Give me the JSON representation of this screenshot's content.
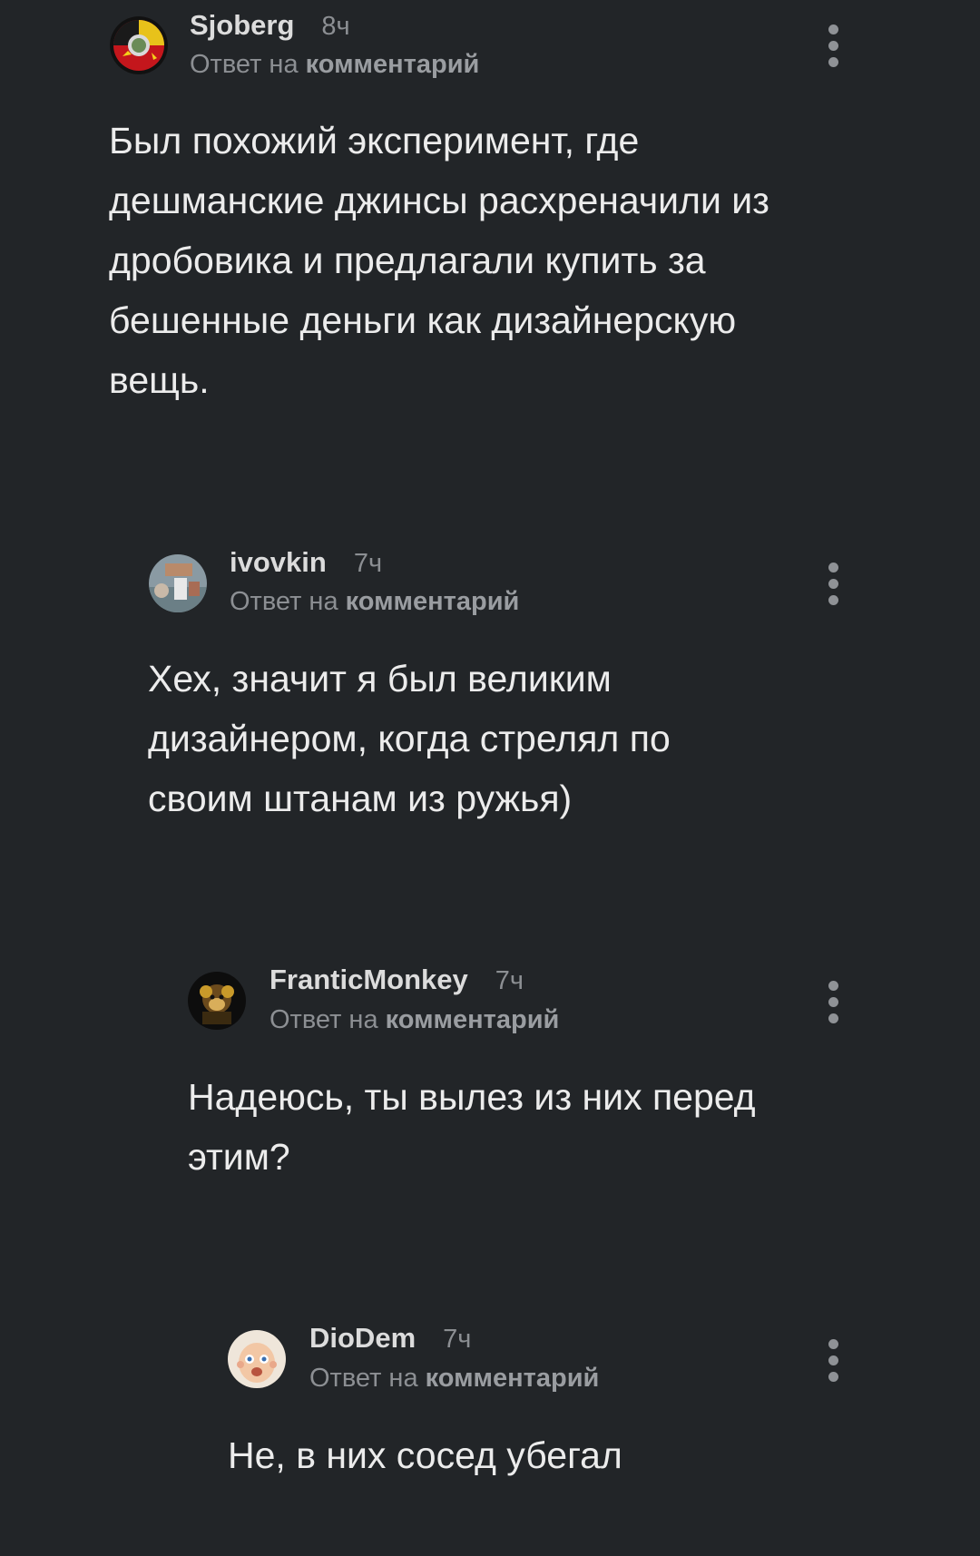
{
  "comments": [
    {
      "username": "Sjoberg",
      "time": "8ч",
      "reply_prefix": "Ответ на",
      "reply_link": "комментарий",
      "text": "Был похожий эксперимент, где дешманские джинсы расхреначили из дробовика и предлагали купить за бешенные деньги как  дизайнерскую вещь.",
      "avatar_icon": "soviet-emblem-avatar"
    },
    {
      "username": "ivovkin",
      "time": "7ч",
      "reply_prefix": "Ответ на",
      "reply_link": "комментарий",
      "text": "Хех, значит я был великим дизайнером, когда стрелял по своим штанам из ружья)",
      "avatar_icon": "photo-avatar"
    },
    {
      "username": "FranticMonkey",
      "time": "7ч",
      "reply_prefix": "Ответ на",
      "reply_link": "комментарий",
      "text": "Надеюсь, ты вылез из них перед этим?",
      "avatar_icon": "monkey-avatar"
    },
    {
      "username": "DioDem",
      "time": "7ч",
      "reply_prefix": "Ответ на",
      "reply_link": "комментарий",
      "text": "Не, в них сосед убегал",
      "avatar_icon": "baby-avatar"
    }
  ],
  "colors": {
    "background": "#222528",
    "text": "#ececec",
    "muted": "#8c8f93"
  }
}
